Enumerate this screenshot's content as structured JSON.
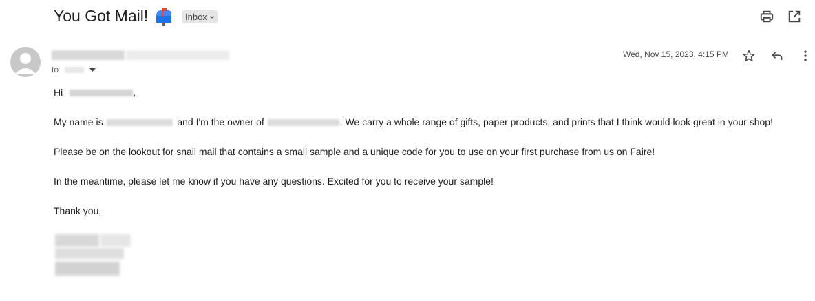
{
  "email": {
    "subject": "You Got Mail!",
    "label_chip": {
      "text": "Inbox",
      "close": "×"
    },
    "sender": {
      "to_prefix": "to",
      "date": "Wed, Nov 15, 2023, 4:15 PM"
    },
    "body": {
      "greeting_prefix": "Hi",
      "greeting_suffix": ",",
      "line1_a": "My name is",
      "line1_b": "and I'm the owner of",
      "line1_c": ". We carry a whole range of gifts, paper products, and prints that I think would look great in your shop!",
      "line2": "Please be on the lookout for snail mail that contains a small sample and a unique code for you to use on your first purchase from us on Faire!",
      "line3": "In the meantime, please let me know if you have any questions. Excited for you to receive your sample!",
      "closing": "Thank you,"
    }
  },
  "icons": {
    "mailbox": "mailbox-icon",
    "print": "print-icon",
    "open_new_window": "open-in-new-window-icon",
    "star": "star-icon",
    "reply": "reply-icon",
    "more": "more-vertical-icon",
    "dropdown": "chevron-down-icon"
  }
}
